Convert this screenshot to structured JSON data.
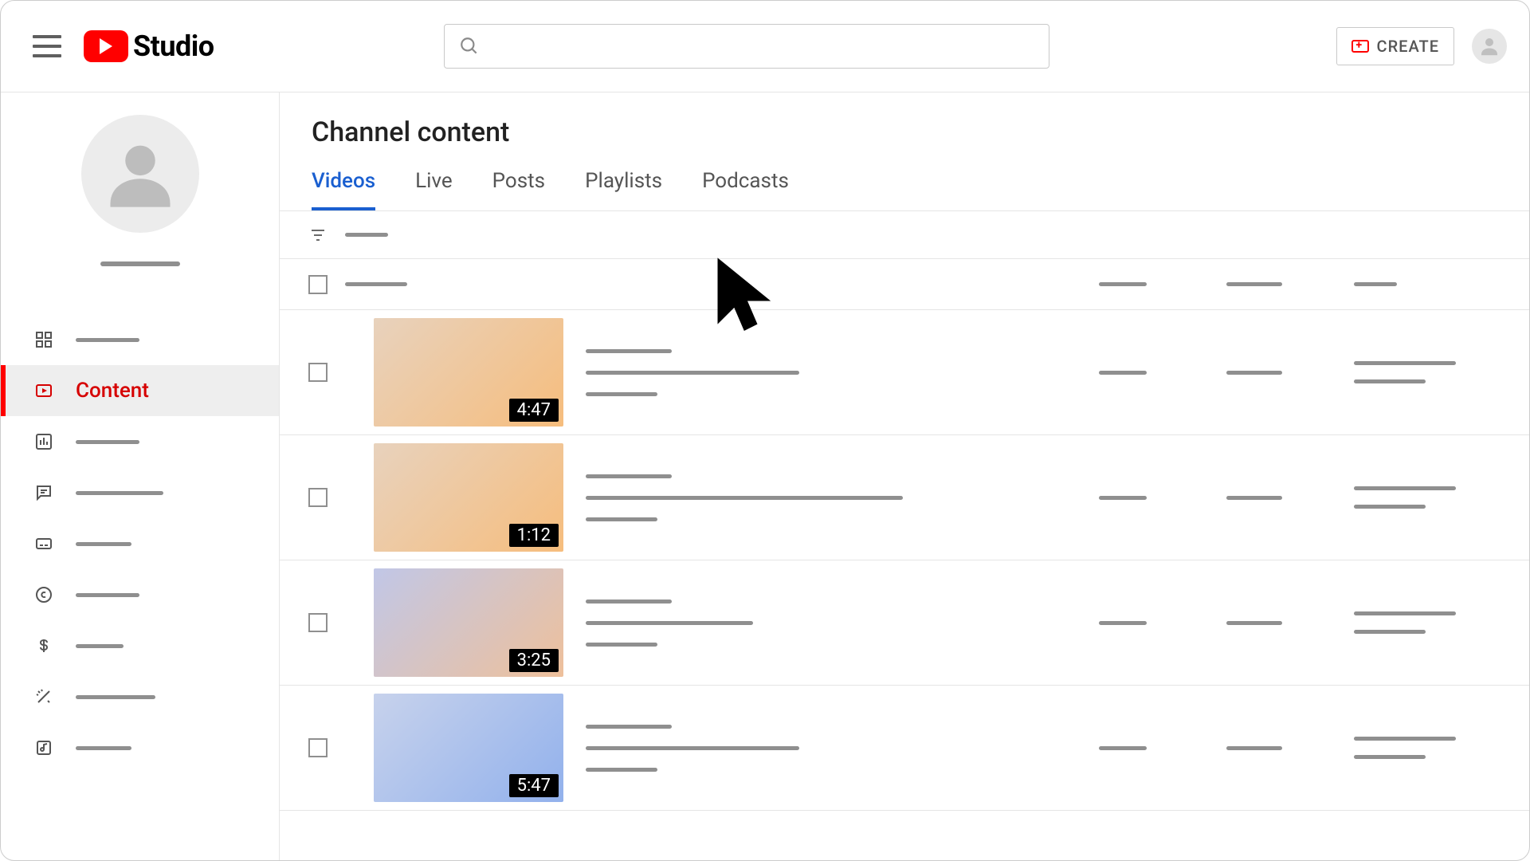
{
  "header": {
    "logo_text": "Studio",
    "search_placeholder": "",
    "create_label": "CREATE"
  },
  "sidebar": {
    "items": [
      {
        "id": "dashboard",
        "label": ""
      },
      {
        "id": "content",
        "label": "Content"
      },
      {
        "id": "analytics",
        "label": ""
      },
      {
        "id": "comments",
        "label": ""
      },
      {
        "id": "subtitles",
        "label": ""
      },
      {
        "id": "copyright",
        "label": ""
      },
      {
        "id": "earn",
        "label": ""
      },
      {
        "id": "customize",
        "label": ""
      },
      {
        "id": "audio",
        "label": ""
      }
    ]
  },
  "main": {
    "title": "Channel content",
    "tabs": [
      {
        "id": "videos",
        "label": "Videos",
        "active": true
      },
      {
        "id": "live",
        "label": "Live"
      },
      {
        "id": "posts",
        "label": "Posts"
      },
      {
        "id": "playlists",
        "label": "Playlists"
      },
      {
        "id": "podcasts",
        "label": "Podcasts"
      }
    ],
    "videos": [
      {
        "duration": "4:47",
        "thumb_class": "orange",
        "desc_width": 268
      },
      {
        "duration": "1:12",
        "thumb_class": "orange",
        "desc_width": 398
      },
      {
        "duration": "3:25",
        "thumb_class": "mix",
        "desc_width": 210
      },
      {
        "duration": "5:47",
        "thumb_class": "blue",
        "desc_width": 268
      }
    ]
  }
}
